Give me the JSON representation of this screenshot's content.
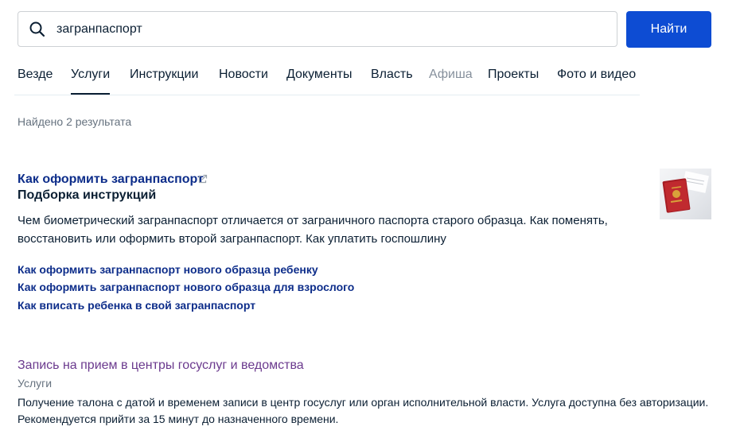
{
  "search": {
    "value": "загранпаспорт",
    "button_label": "Найти"
  },
  "tabs": [
    {
      "label": "Везде",
      "active": false,
      "muted": false
    },
    {
      "label": "Услуги",
      "active": true,
      "muted": false
    },
    {
      "label": "Инструкции",
      "active": false,
      "muted": false
    },
    {
      "label": "Новости",
      "active": false,
      "muted": false
    },
    {
      "label": "Документы",
      "active": false,
      "muted": false
    },
    {
      "label": "Власть",
      "active": false,
      "muted": false
    },
    {
      "label": "Афиша",
      "active": false,
      "muted": true
    },
    {
      "label": "Проекты",
      "active": false,
      "muted": false
    },
    {
      "label": "Фото и видео",
      "active": false,
      "muted": false
    }
  ],
  "results_count_text": "Найдено 2 результата",
  "results": [
    {
      "title": "Как оформить загранпаспорт",
      "subtitle": "Подборка инструкций",
      "description": "Чем биометрический загранпаспорт отличается от заграничного паспорта старого образца. Как поменять, восстановить или оформить второй загранпаспорт. Как уплатить госпошлину",
      "links": [
        "Как оформить загранпаспорт нового образца ребенку",
        "Как оформить загранпаспорт нового образца для взрослого",
        "Как вписать ребенка в свой загранпаспорт"
      ],
      "thumbnail_icon": "passport-image"
    },
    {
      "title": "Запись на прием в центры госуслуг и ведомства",
      "category": "Услуги",
      "description": "Получение талона с датой и временем записи в центр госуслуг или орган исполнительной власти. Услуга доступна без авторизации. Рекомендуется прийти за 15 минут до назначенного времени."
    }
  ],
  "colors": {
    "primary_button": "#0d4cd3",
    "link": "#0d2d8a",
    "visited_link": "#6b3a8e",
    "text": "#0b1f33",
    "muted_text": "#66727f"
  }
}
